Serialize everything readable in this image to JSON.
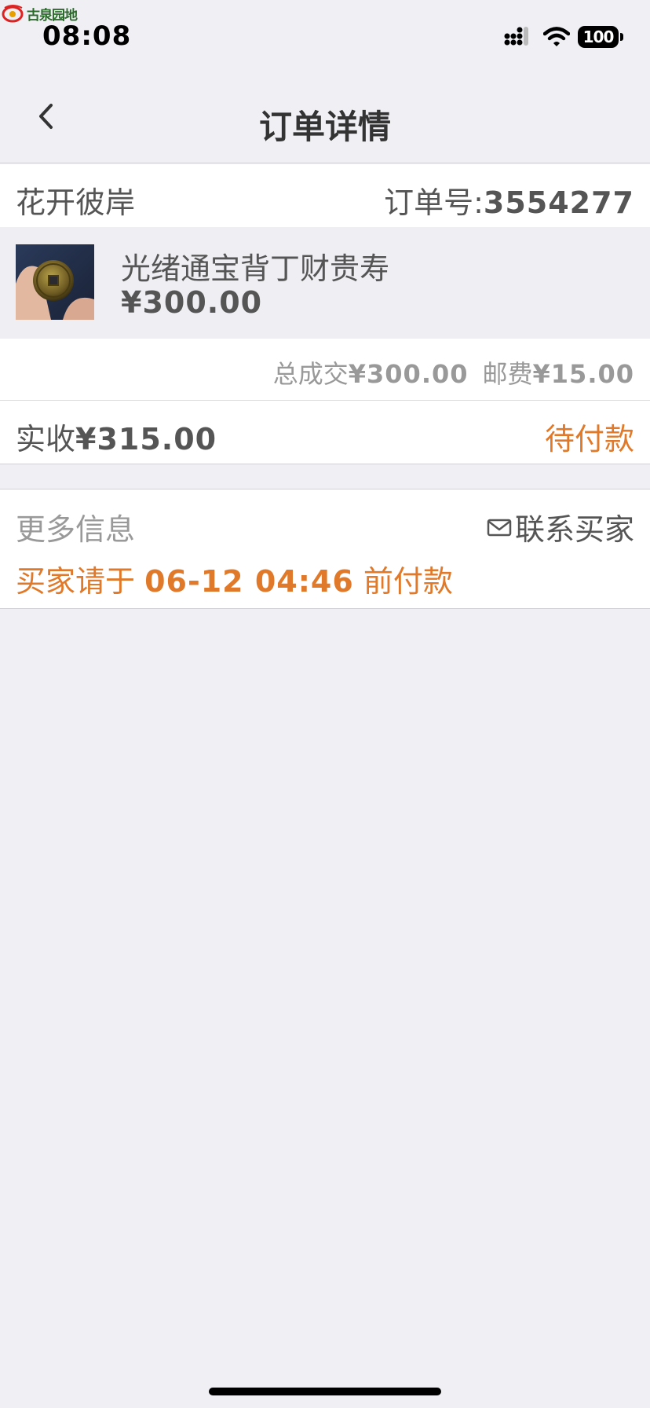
{
  "watermark": {
    "text": "古泉园地"
  },
  "status_bar": {
    "time": "08:08",
    "battery": "100"
  },
  "nav": {
    "title": "订单详情",
    "back_icon": "chevron-left-icon"
  },
  "order": {
    "seller": "花开彼岸",
    "order_no_label": "订单号:",
    "order_no": "3554277",
    "item": {
      "title": "光绪通宝背丁财贵寿",
      "price": "¥300.00"
    },
    "total_label": "总成交",
    "total_value": "¥300.00",
    "shipping_label": "邮费",
    "shipping_value": "¥15.00",
    "received_label": "实收",
    "received_value": "¥315.00",
    "status": "待付款"
  },
  "more_info": {
    "title": "更多信息",
    "contact_label": "联系买家",
    "deadline_prefix": "买家请于 ",
    "deadline_time": "06-12 04:46",
    "deadline_suffix": " 前付款"
  },
  "colors": {
    "accent": "#e07a2a",
    "background": "#efeff4",
    "text": "#555555",
    "muted": "#999999"
  }
}
